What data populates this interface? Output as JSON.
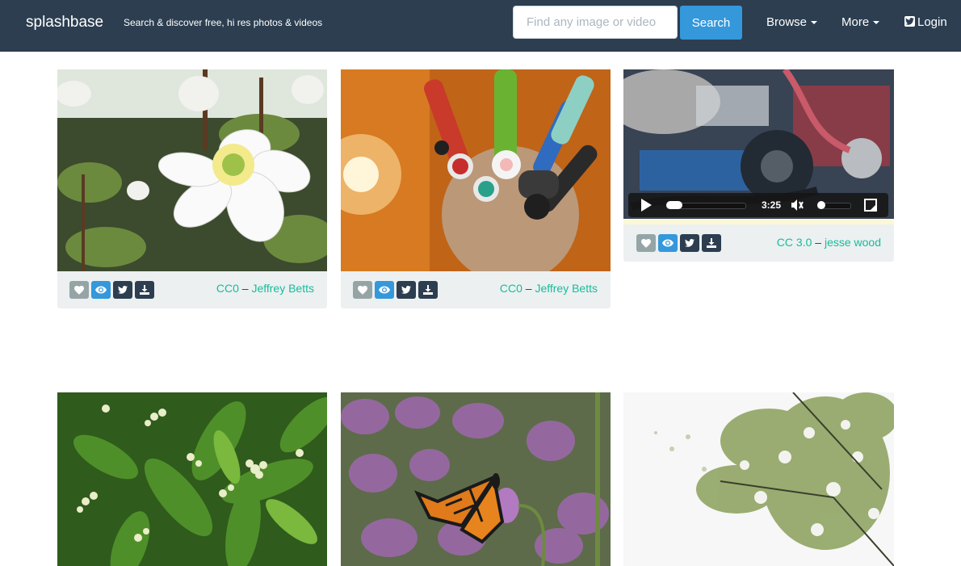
{
  "nav": {
    "brand": "splashbase",
    "tagline": "Search & discover free, hi res photos & videos",
    "search_placeholder": "Find any image or video",
    "search_button": "Search",
    "browse": "Browse",
    "more": "More",
    "login": "Login"
  },
  "cards": [
    {
      "license": "CC0",
      "separator": "–",
      "author": "Jeffrey Betts",
      "image": "white-anemone-flower"
    },
    {
      "license": "CC0",
      "separator": "–",
      "author": "Jeffrey Betts",
      "image": "markers-in-cup"
    },
    {
      "license": "CC 3.0",
      "separator": "–",
      "author": "jesse wood",
      "image": "car-engine-video",
      "video_time": "3:25"
    },
    {
      "image": "green-leaves-buds"
    },
    {
      "image": "monarch-butterfly-verbena"
    },
    {
      "image": "white-blossom-tree"
    }
  ],
  "icons": [
    "heart-icon",
    "eye-icon",
    "twitter-icon",
    "download-icon",
    "play-icon",
    "volume-icon",
    "fullscreen-icon"
  ],
  "colors": {
    "navbar": "#2c3e50",
    "accent": "#18bc9c",
    "primary": "#3498db",
    "card_bg": "#ecf0f1"
  }
}
